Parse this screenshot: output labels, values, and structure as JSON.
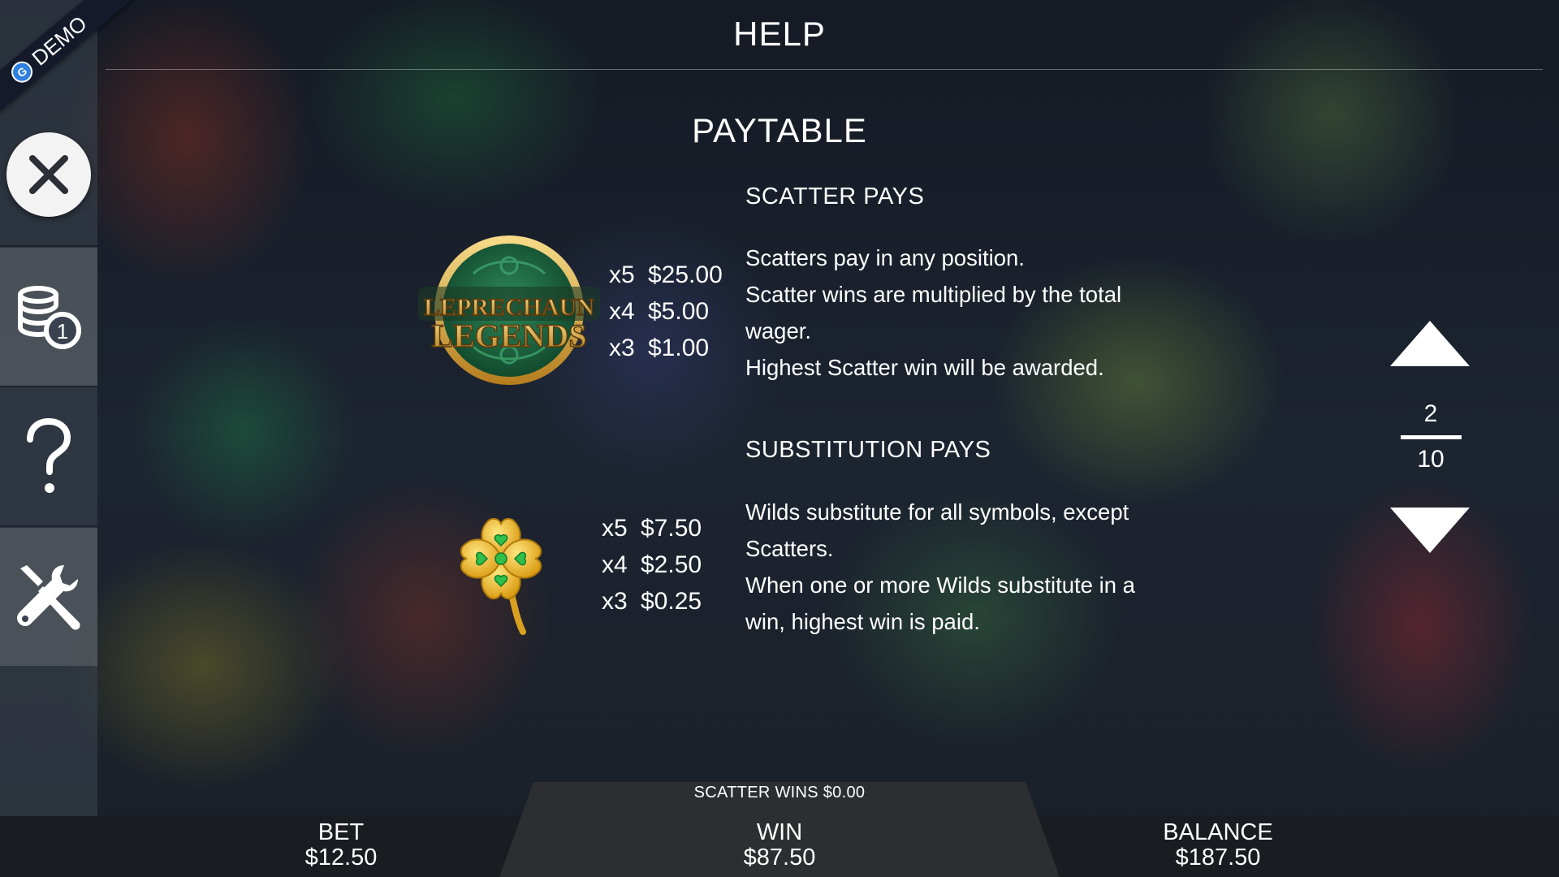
{
  "header": {
    "title": "HELP"
  },
  "demo_badge": {
    "label": "DEMO"
  },
  "sidebar": {
    "items": [
      {
        "name": "close",
        "icon": "close-icon"
      },
      {
        "name": "bet-settings",
        "icon": "coins-icon",
        "badge": "1"
      },
      {
        "name": "help",
        "icon": "question-mark-icon"
      },
      {
        "name": "settings",
        "icon": "tools-icon"
      }
    ]
  },
  "paytable": {
    "title": "PAYTABLE",
    "scatter": {
      "title": "SCATTER PAYS",
      "symbol": "leprechaun-legends-logo",
      "logo_line1": "LEPRECHAUN",
      "logo_line2": "LEGENDS",
      "pays": [
        {
          "mult": "x5",
          "amount": "$25.00"
        },
        {
          "mult": "x4",
          "amount": "$5.00"
        },
        {
          "mult": "x3",
          "amount": "$1.00"
        }
      ],
      "description": [
        "Scatters pay in any position.",
        "Scatter wins are multiplied by the total wager.",
        "Highest Scatter win will be awarded."
      ]
    },
    "substitution": {
      "title": "SUBSTITUTION PAYS",
      "symbol": "four-leaf-clover",
      "pays": [
        {
          "mult": "x5",
          "amount": "$7.50"
        },
        {
          "mult": "x4",
          "amount": "$2.50"
        },
        {
          "mult": "x3",
          "amount": "$0.25"
        }
      ],
      "description": [
        "Wilds substitute for all symbols, except Scatters.",
        "When one or more Wilds substitute in a win, highest win is paid."
      ]
    }
  },
  "pager": {
    "current": "2",
    "total": "10"
  },
  "bottom_bar": {
    "scatter_wins": "SCATTER WINS $0.00",
    "bet_label": "BET",
    "bet_value": "$12.50",
    "win_label": "WIN",
    "win_value": "$87.50",
    "balance_label": "BALANCE",
    "balance_value": "$187.50"
  },
  "colors": {
    "clover_gold": "#f2c230",
    "clover_gem": "#2fbf4a",
    "logo_green": "#1f6b45",
    "logo_gold": "#d9a93a"
  }
}
